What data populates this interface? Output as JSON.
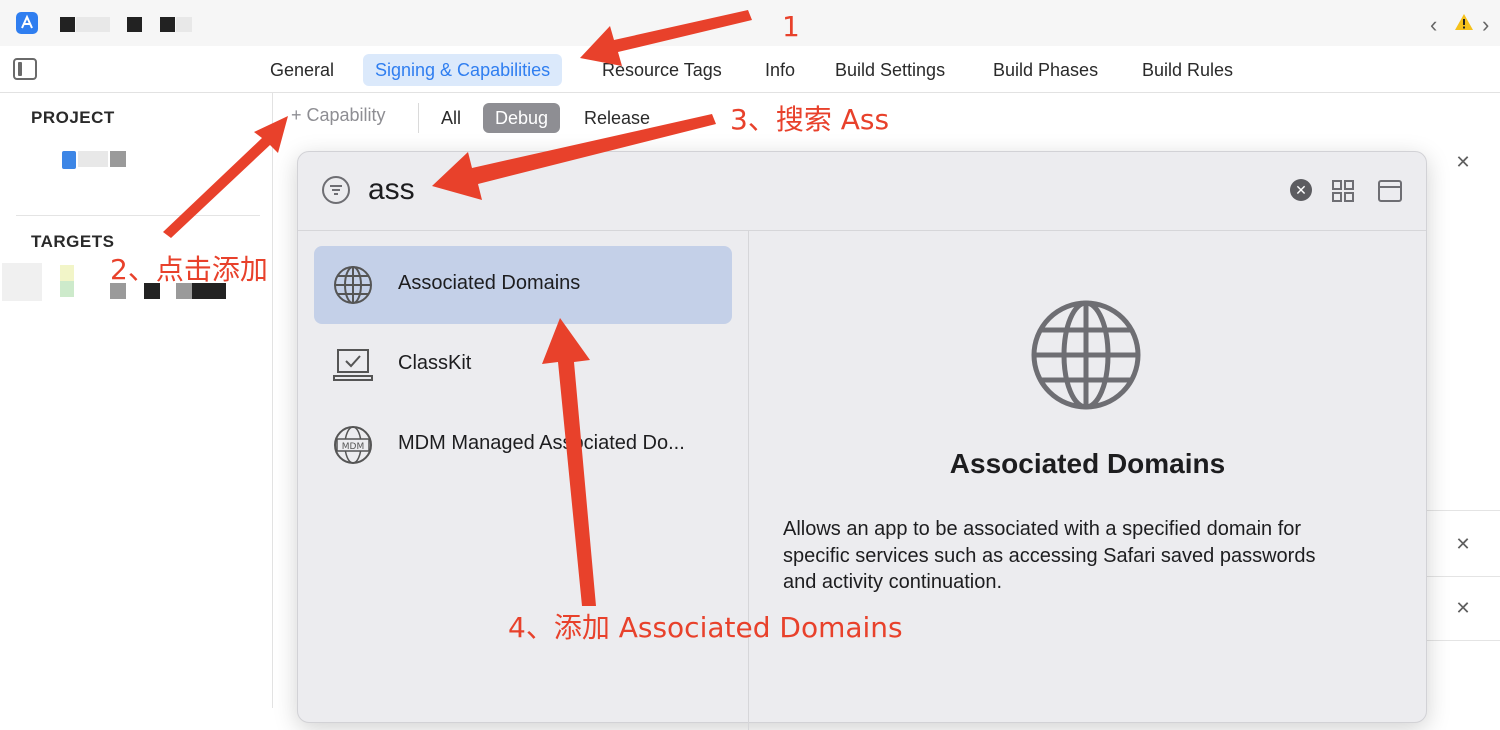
{
  "tabs": [
    {
      "label": "General"
    },
    {
      "label": "Signing & Capabilities",
      "active": true
    },
    {
      "label": "Resource Tags"
    },
    {
      "label": "Info"
    },
    {
      "label": "Build Settings"
    },
    {
      "label": "Build Phases"
    },
    {
      "label": "Build Rules"
    }
  ],
  "sidebar": {
    "project_title": "PROJECT",
    "targets_title": "TARGETS"
  },
  "capbar": {
    "add_capability": "+ Capability",
    "segments": [
      "All",
      "Debug",
      "Release"
    ],
    "active_segment": "Debug"
  },
  "library": {
    "search_value": "ass",
    "items": [
      {
        "label": "Associated Domains",
        "icon": "globe-icon",
        "selected": true
      },
      {
        "label": "ClassKit",
        "icon": "classkit-icon"
      },
      {
        "label": "MDM Managed Associated Do...",
        "icon": "mdm-globe-icon"
      }
    ],
    "detail": {
      "title": "Associated Domains",
      "description_lines": [
        "Allows an app to be associated with a specified domain for",
        "specific services such as accessing Safari saved passwords",
        "and activity continuation."
      ]
    }
  },
  "annotations": {
    "step1": "1",
    "step2": "2、点击添加",
    "step3": "3、搜索 Ass",
    "step4": "4、添加 Associated Domains"
  },
  "colors": {
    "accent": "#2f7ef0",
    "tab_active_bg": "#dbe9fb",
    "annotation": "#e8412b",
    "selected_row": "#c4d0e8",
    "segment_active": "#8e8e93"
  }
}
